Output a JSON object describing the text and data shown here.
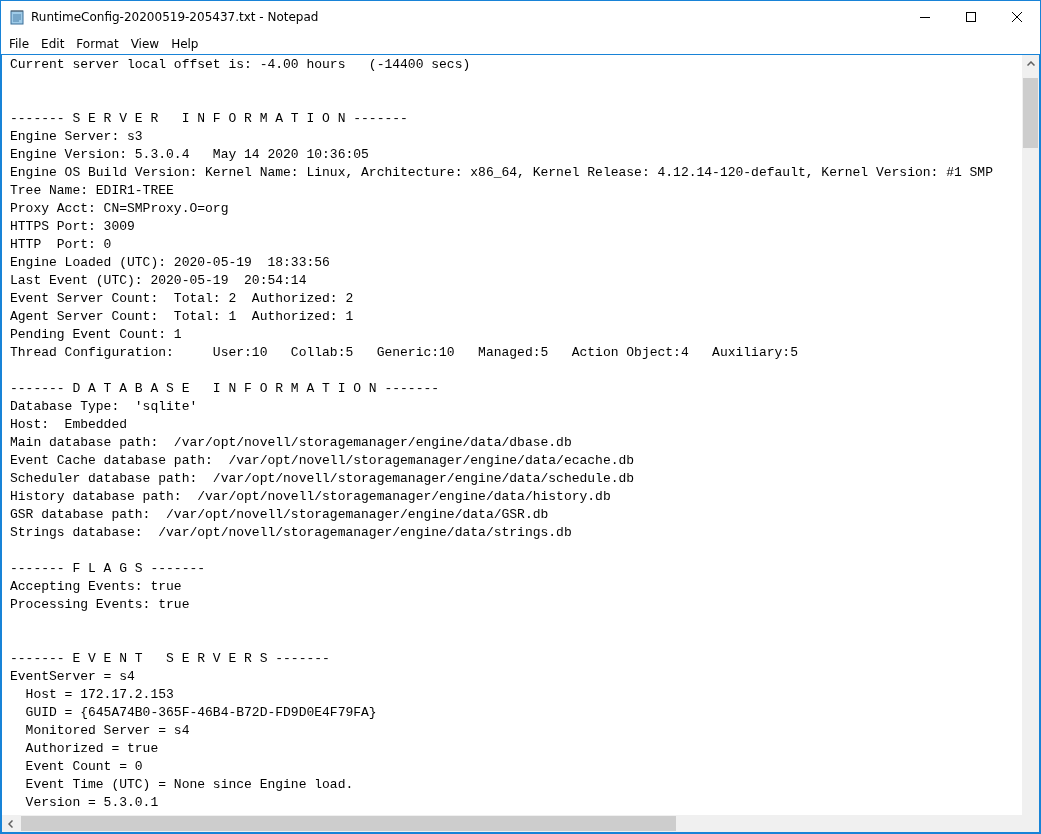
{
  "window": {
    "title": "RuntimeConfig-20200519-205437.txt - Notepad"
  },
  "menu": [
    "File",
    "Edit",
    "Format",
    "View",
    "Help"
  ],
  "document": {
    "lines": [
      {
        "kind": "text",
        "text": "Current server local offset is: -4.00 hours   (-14400 secs)"
      },
      {
        "kind": "blank"
      },
      {
        "kind": "blank"
      },
      {
        "kind": "text",
        "text": "------- S E R V E R   I N F O R M A T I O N -------"
      },
      {
        "kind": "text",
        "text": "Engine Server: s3"
      },
      {
        "kind": "text",
        "text": "Engine Version: 5.3.0.4   May 14 2020 10:36:05"
      },
      {
        "kind": "text",
        "text": "Engine OS Build Version: Kernel Name: Linux, Architecture: x86_64, Kernel Release: 4.12.14-120-default, Kernel Version: #1 SMP"
      },
      {
        "kind": "text",
        "text": "Tree Name: EDIR1-TREE"
      },
      {
        "kind": "text",
        "text": "Proxy Acct: CN=SMProxy.O=org"
      },
      {
        "kind": "text",
        "text": "HTTPS Port: 3009"
      },
      {
        "kind": "text",
        "text": "HTTP  Port: 0"
      },
      {
        "kind": "text",
        "text": "Engine Loaded (UTC): 2020-05-19  18:33:56"
      },
      {
        "kind": "text",
        "text": "Last Event (UTC): 2020-05-19  20:54:14"
      },
      {
        "kind": "text",
        "text": "Event Server Count:  Total: 2  Authorized: 2"
      },
      {
        "kind": "text",
        "text": "Agent Server Count:  Total: 1  Authorized: 1"
      },
      {
        "kind": "text",
        "text": "Pending Event Count: 1"
      },
      {
        "kind": "text",
        "text": "Thread Configuration:     User:10   Collab:5   Generic:10   Managed:5   Action Object:4   Auxiliary:5"
      },
      {
        "kind": "blank"
      },
      {
        "kind": "text",
        "text": "------- D A T A B A S E   I N F O R M A T I O N -------"
      },
      {
        "kind": "text",
        "text": "Database Type:  'sqlite'"
      },
      {
        "kind": "text",
        "text": "Host:  Embedded"
      },
      {
        "kind": "text",
        "text": "Main database path:  /var/opt/novell/storagemanager/engine/data/dbase.db"
      },
      {
        "kind": "text",
        "text": "Event Cache database path:  /var/opt/novell/storagemanager/engine/data/ecache.db"
      },
      {
        "kind": "text",
        "text": "Scheduler database path:  /var/opt/novell/storagemanager/engine/data/schedule.db"
      },
      {
        "kind": "text",
        "text": "History database path:  /var/opt/novell/storagemanager/engine/data/history.db"
      },
      {
        "kind": "text",
        "text": "GSR database path:  /var/opt/novell/storagemanager/engine/data/GSR.db"
      },
      {
        "kind": "text",
        "text": "Strings database:  /var/opt/novell/storagemanager/engine/data/strings.db"
      },
      {
        "kind": "blank"
      },
      {
        "kind": "text",
        "text": "------- F L A G S -------"
      },
      {
        "kind": "text",
        "text": "Accepting Events: true"
      },
      {
        "kind": "text",
        "text": "Processing Events: true"
      },
      {
        "kind": "blank"
      },
      {
        "kind": "blank"
      },
      {
        "kind": "text",
        "text": "------- E V E N T   S E R V E R S -------"
      },
      {
        "kind": "text",
        "text": "EventServer = s4"
      },
      {
        "kind": "text",
        "text": "  Host = 172.17.2.153"
      },
      {
        "kind": "text",
        "text": "  GUID = {645A74B0-365F-46B4-B72D-FD9D0E4F79FA}"
      },
      {
        "kind": "text",
        "text": "  Monitored Server = s4"
      },
      {
        "kind": "text",
        "text": "  Authorized = true"
      },
      {
        "kind": "text",
        "text": "  Event Count = 0"
      },
      {
        "kind": "text",
        "text": "  Event Time (UTC) = None since Engine load."
      },
      {
        "kind": "text",
        "text": "  Version = 5.3.0.1"
      }
    ]
  }
}
